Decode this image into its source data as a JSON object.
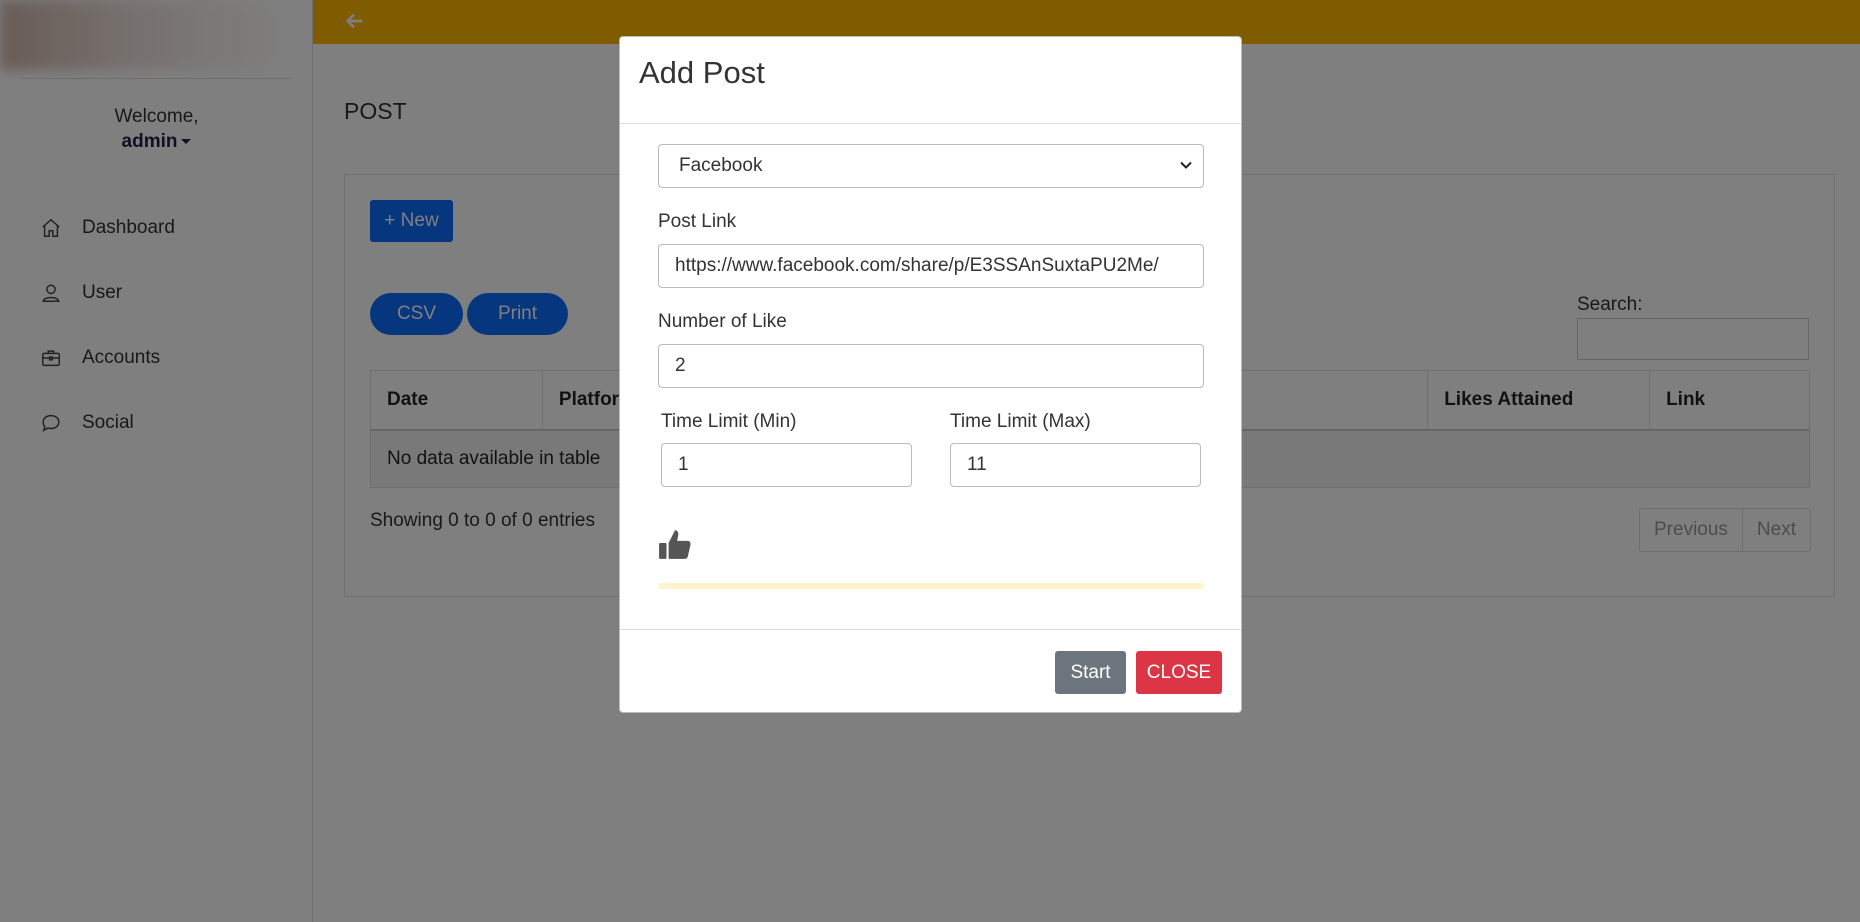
{
  "sidebar": {
    "welcome": "Welcome,",
    "user": "admin",
    "items": [
      {
        "label": "Dashboard",
        "icon": "home-icon"
      },
      {
        "label": "User",
        "icon": "user-icon"
      },
      {
        "label": "Accounts",
        "icon": "briefcase-icon"
      },
      {
        "label": "Social",
        "icon": "chat-icon"
      }
    ]
  },
  "header": {
    "accent": "#ffb800",
    "back_icon": "arrow-left-icon"
  },
  "main": {
    "page_title": "POST",
    "new_button": "+ New",
    "csv_button": "CSV",
    "print_button": "Print",
    "search_label": "Search:",
    "table": {
      "columns": [
        "Date",
        "Platform",
        "Likes Attained",
        "Link"
      ],
      "empty_message": "No data available in table"
    },
    "showing": "Showing 0 to 0 of 0 entries",
    "pagination": {
      "previous": "Previous",
      "next": "Next"
    }
  },
  "modal": {
    "title": "Add Post",
    "platform_selected": "Facebook",
    "post_link_label": "Post Link",
    "post_link_value": "https://www.facebook.com/share/p/E3SSAnSuxtaPU2Me/",
    "likes_label": "Number of Like",
    "likes_value": "2",
    "time_min_label": "Time Limit (Min)",
    "time_min_value": "1",
    "time_max_label": "Time Limit (Max)",
    "time_max_value": "11",
    "thumb_icon": "thumbs-up-icon",
    "start_button": "Start",
    "close_button": "CLOSE"
  }
}
